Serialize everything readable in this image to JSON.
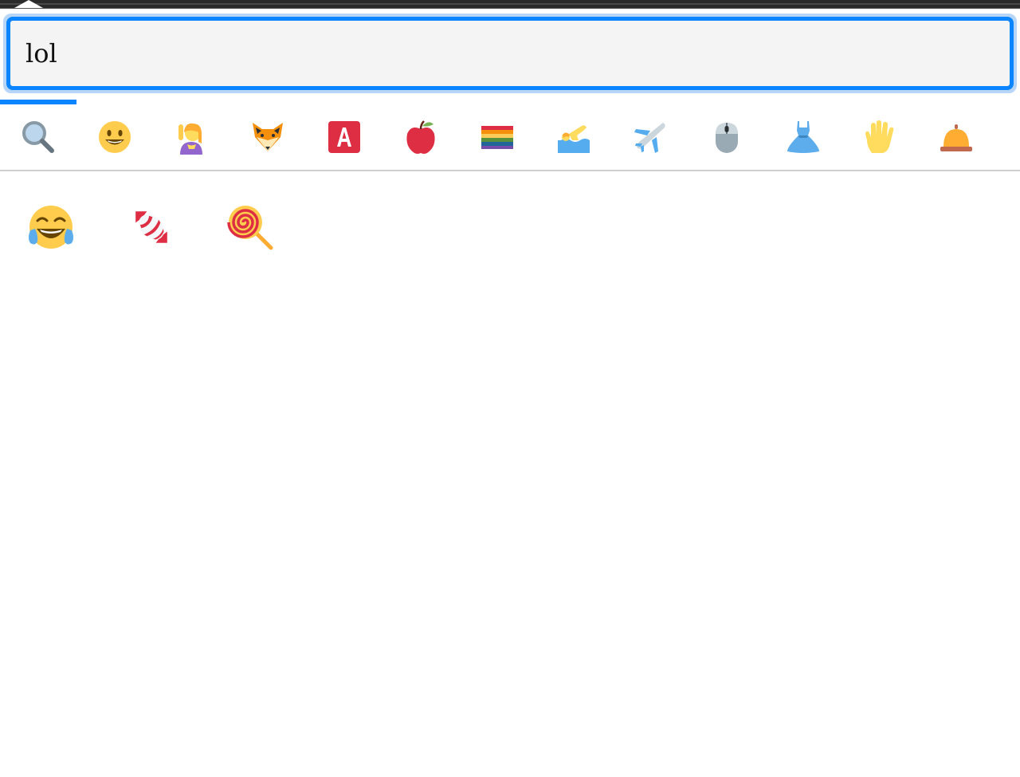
{
  "search": {
    "value": "lol"
  },
  "categories": [
    {
      "name": "search-icon"
    },
    {
      "name": "smileys-icon"
    },
    {
      "name": "people-icon"
    },
    {
      "name": "animals-icon"
    },
    {
      "name": "symbols-icon"
    },
    {
      "name": "food-icon"
    },
    {
      "name": "flags-icon"
    },
    {
      "name": "activities-icon"
    },
    {
      "name": "travel-icon"
    },
    {
      "name": "objects-icon"
    },
    {
      "name": "clothing-icon"
    },
    {
      "name": "gestures-icon"
    },
    {
      "name": "bell-icon"
    }
  ],
  "results": [
    {
      "name": "face-with-tears-of-joy-emoji"
    },
    {
      "name": "candy-emoji"
    },
    {
      "name": "lollipop-emoji"
    }
  ]
}
